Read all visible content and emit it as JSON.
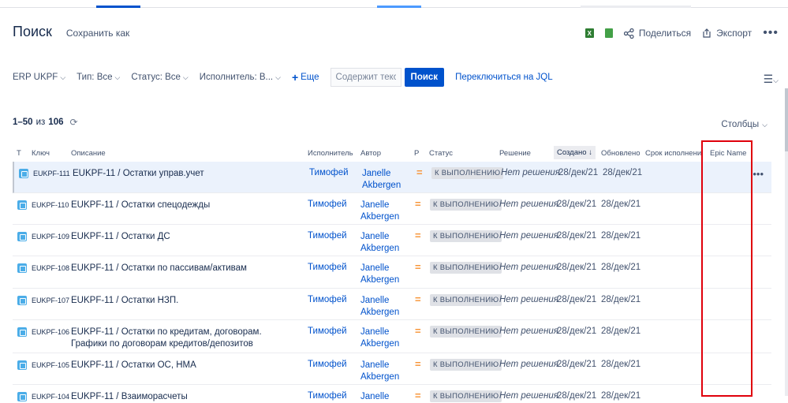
{
  "header": {
    "title": "Поиск",
    "save_as": "Сохранить как"
  },
  "actions": {
    "share": "Поделиться",
    "export": "Экспорт",
    "more": "•••"
  },
  "filters": {
    "project": "ERP UKPF",
    "type": "Тип: Все",
    "status": "Статус: Все",
    "assignee": "Исполнитель: В...",
    "more": "Еще",
    "search_placeholder": "Содержит текст",
    "search_button": "Поиск",
    "switch_jql": "Переключиться на JQL"
  },
  "results": {
    "range": "1–50",
    "of": "из",
    "total": "106"
  },
  "columns_button": "Столбцы",
  "table": {
    "headers": {
      "type": "Т",
      "key": "Ключ",
      "summary": "Описание",
      "assignee": "Исполнитель",
      "author": "Автор",
      "priority": "P",
      "status": "Статус",
      "resolution": "Решение",
      "created": "Создано",
      "updated": "Обновлено",
      "due": "Срок исполнени",
      "epic": "Epic Name"
    },
    "rows": [
      {
        "key": "EUKPF-111",
        "parent": "EUKPF-11",
        "summary": "Остатки управ.учет",
        "assignee": "Тимофей",
        "author": "Janelle Akbergen",
        "status": "К ВЫПОЛНЕНИЮ",
        "resolution": "Нет решения",
        "created": "28/дек/21",
        "updated": "28/дек/21"
      },
      {
        "key": "EUKPF-110",
        "parent": "EUKPF-11",
        "summary": "Остатки спецодежды",
        "assignee": "Тимофей",
        "author": "Janelle Akbergen",
        "status": "К ВЫПОЛНЕНИЮ",
        "resolution": "Нет решения",
        "created": "28/дек/21",
        "updated": "28/дек/21"
      },
      {
        "key": "EUKPF-109",
        "parent": "EUKPF-11",
        "summary": "Остатки ДС",
        "assignee": "Тимофей",
        "author": "Janelle Akbergen",
        "status": "К ВЫПОЛНЕНИЮ",
        "resolution": "Нет решения",
        "created": "28/дек/21",
        "updated": "28/дек/21"
      },
      {
        "key": "EUKPF-108",
        "parent": "EUKPF-11",
        "summary": "Остатки по пассивам/активам",
        "assignee": "Тимофей",
        "author": "Janelle Akbergen",
        "status": "К ВЫПОЛНЕНИЮ",
        "resolution": "Нет решения",
        "created": "28/дек/21",
        "updated": "28/дек/21"
      },
      {
        "key": "EUKPF-107",
        "parent": "EUKPF-11",
        "summary": "Остатки НЗП.",
        "assignee": "Тимофей",
        "author": "Janelle Akbergen",
        "status": "К ВЫПОЛНЕНИЮ",
        "resolution": "Нет решения",
        "created": "28/дек/21",
        "updated": "28/дек/21"
      },
      {
        "key": "EUKPF-106",
        "parent": "EUKPF-11",
        "summary": "Остатки по кредитам, договорам. Графики по договорам кредитов/депозитов",
        "assignee": "Тимофей",
        "author": "Janelle Akbergen",
        "status": "К ВЫПОЛНЕНИЮ",
        "resolution": "Нет решения",
        "created": "28/дек/21",
        "updated": "28/дек/21"
      },
      {
        "key": "EUKPF-105",
        "parent": "EUKPF-11",
        "summary": "Остатки ОС, НМА",
        "assignee": "Тимофей",
        "author": "Janelle Akbergen",
        "status": "К ВЫПОЛНЕНИЮ",
        "resolution": "Нет решения",
        "created": "28/дек/21",
        "updated": "28/дек/21"
      },
      {
        "key": "EUKPF-104",
        "parent": "EUKPF-11",
        "summary": "Взаиморасчеты",
        "assignee": "Тимофей",
        "author": "Janelle",
        "status": "К ВЫПОЛНЕНИЮ",
        "resolution": "Нет решения",
        "created": "28/дек/21",
        "updated": "28/дек/21"
      }
    ]
  }
}
